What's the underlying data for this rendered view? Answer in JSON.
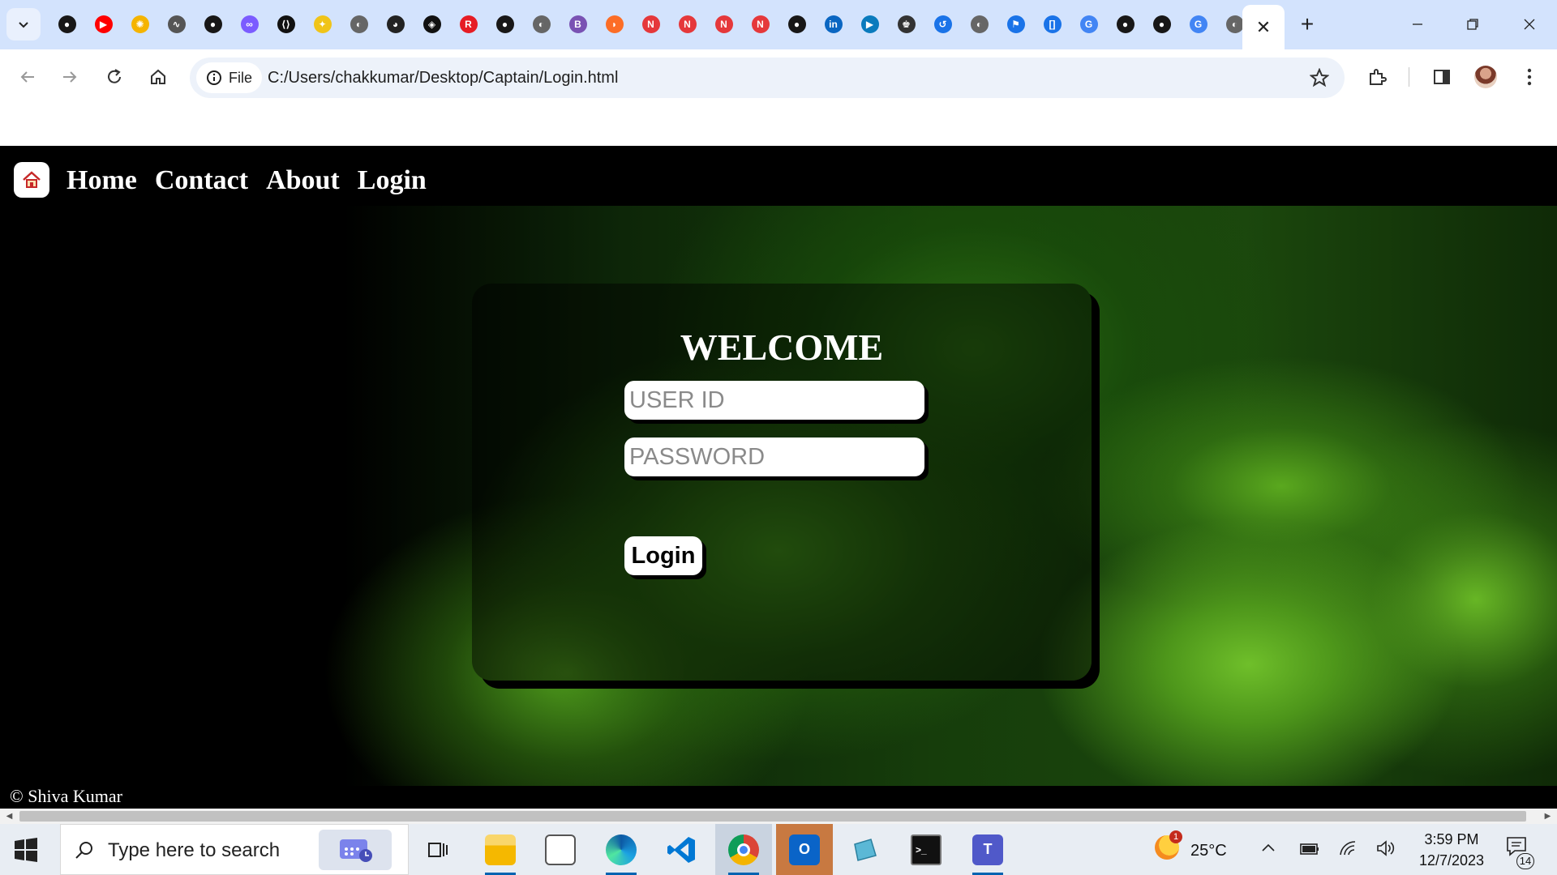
{
  "browser": {
    "address_chip_label": "File",
    "url": "C:/Users/chakkumar/Desktop/Captain/Login.html",
    "tab_favicons": [
      {
        "icon": "github-icon",
        "color": "#181717",
        "glyph": "●"
      },
      {
        "icon": "youtube-icon",
        "color": "#ff0000",
        "glyph": "▶"
      },
      {
        "icon": "sun-icon",
        "color": "#f5b400",
        "glyph": "✺"
      },
      {
        "icon": "chart-icon",
        "color": "#555555",
        "glyph": "∿"
      },
      {
        "icon": "github-icon",
        "color": "#181717",
        "glyph": "●"
      },
      {
        "icon": "link-icon",
        "color": "#7b5cff",
        "glyph": "∞"
      },
      {
        "icon": "code-icon",
        "color": "#111111",
        "glyph": "⟨⟩"
      },
      {
        "icon": "bulb-icon",
        "color": "#f0c419",
        "glyph": "✦"
      },
      {
        "icon": "globe-icon",
        "color": "#666666",
        "glyph": "◐"
      },
      {
        "icon": "colab-icon",
        "color": "#222222",
        "glyph": "◕"
      },
      {
        "icon": "codepen-icon",
        "color": "#111111",
        "glyph": "◈"
      },
      {
        "icon": "recursion-icon",
        "color": "#e61c24",
        "glyph": "R"
      },
      {
        "icon": "github-icon",
        "color": "#181717",
        "glyph": "●"
      },
      {
        "icon": "globe-icon",
        "color": "#666666",
        "glyph": "◐"
      },
      {
        "icon": "bootstrap-icon",
        "color": "#7952b3",
        "glyph": "B"
      },
      {
        "icon": "swiggy-icon",
        "color": "#fc6d26",
        "glyph": "◗"
      },
      {
        "icon": "n-icon",
        "color": "#e5383b",
        "glyph": "N"
      },
      {
        "icon": "n-icon",
        "color": "#e5383b",
        "glyph": "N"
      },
      {
        "icon": "n-icon",
        "color": "#e5383b",
        "glyph": "N"
      },
      {
        "icon": "n-icon",
        "color": "#e5383b",
        "glyph": "N"
      },
      {
        "icon": "github-icon",
        "color": "#181717",
        "glyph": "●"
      },
      {
        "icon": "linkedin-icon",
        "color": "#0a66c2",
        "glyph": "in"
      },
      {
        "icon": "video-icon",
        "color": "#0a7bbd",
        "glyph": "▶"
      },
      {
        "icon": "people-icon",
        "color": "#333333",
        "glyph": "♚"
      },
      {
        "icon": "history-icon",
        "color": "#1a73e8",
        "glyph": "↺"
      },
      {
        "icon": "globe-icon",
        "color": "#666666",
        "glyph": "◐"
      },
      {
        "icon": "flag-icon",
        "color": "#1a73e8",
        "glyph": "⚑"
      },
      {
        "icon": "bracket-icon",
        "color": "#1a73e8",
        "glyph": "[]"
      },
      {
        "icon": "google-icon",
        "color": "#4285f4",
        "glyph": "G"
      },
      {
        "icon": "github-icon",
        "color": "#181717",
        "glyph": "●"
      },
      {
        "icon": "github-icon",
        "color": "#181717",
        "glyph": "●"
      },
      {
        "icon": "google-icon",
        "color": "#4285f4",
        "glyph": "G"
      },
      {
        "icon": "globe-icon",
        "color": "#666666",
        "glyph": "◐"
      }
    ]
  },
  "page": {
    "nav": [
      "Home",
      "Contact",
      "About",
      "Login"
    ],
    "login_card": {
      "title": "WELCOME",
      "user_placeholder": "USER ID",
      "password_placeholder": "PASSWORD",
      "button_label": "Login"
    },
    "footer": "© Shiva Kumar"
  },
  "taskbar": {
    "search_placeholder": "Type here to search",
    "weather": "25°C",
    "weather_badge": "1",
    "time": "3:59 PM",
    "date": "12/7/2023",
    "notification_count": "14"
  },
  "colors": {
    "tab_strip": "#d3e3fd",
    "omnibox": "#edf2fa",
    "page_background": "#000000",
    "taskbar": "#e8edf3"
  }
}
